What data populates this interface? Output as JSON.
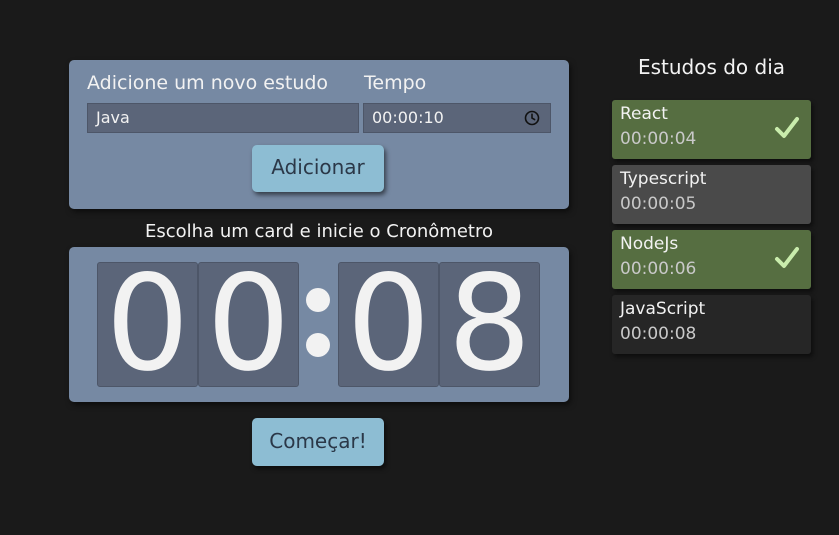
{
  "form": {
    "study_label": "Adicione um novo estudo",
    "time_label": "Tempo",
    "study_value": "Java",
    "time_value": "00:00:10",
    "add_button": "Adicionar"
  },
  "timer": {
    "instruction": "Escolha um card e inicie o Cronômetro",
    "digits": [
      "0",
      "0",
      "0",
      "8"
    ],
    "start_button": "Começar!"
  },
  "sidebar": {
    "title": "Estudos do dia",
    "items": [
      {
        "name": "React",
        "time": "00:00:04",
        "completed": true,
        "selected": false
      },
      {
        "name": "Typescript",
        "time": "00:00:05",
        "completed": false,
        "selected": false
      },
      {
        "name": "NodeJs",
        "time": "00:00:06",
        "completed": true,
        "selected": false
      },
      {
        "name": "JavaScript",
        "time": "00:00:08",
        "completed": false,
        "selected": true
      }
    ]
  },
  "icons": {
    "time_field": "clock-icon",
    "completed": "check-icon"
  },
  "colors": {
    "background": "#1a1a1a",
    "card": "#7689a3",
    "field": "#5b6579",
    "button": "#8dbdd3",
    "item_completed": "#566e41",
    "item_default": "#4a4a4a",
    "item_selected": "#262626",
    "check": "#c9ecac"
  }
}
